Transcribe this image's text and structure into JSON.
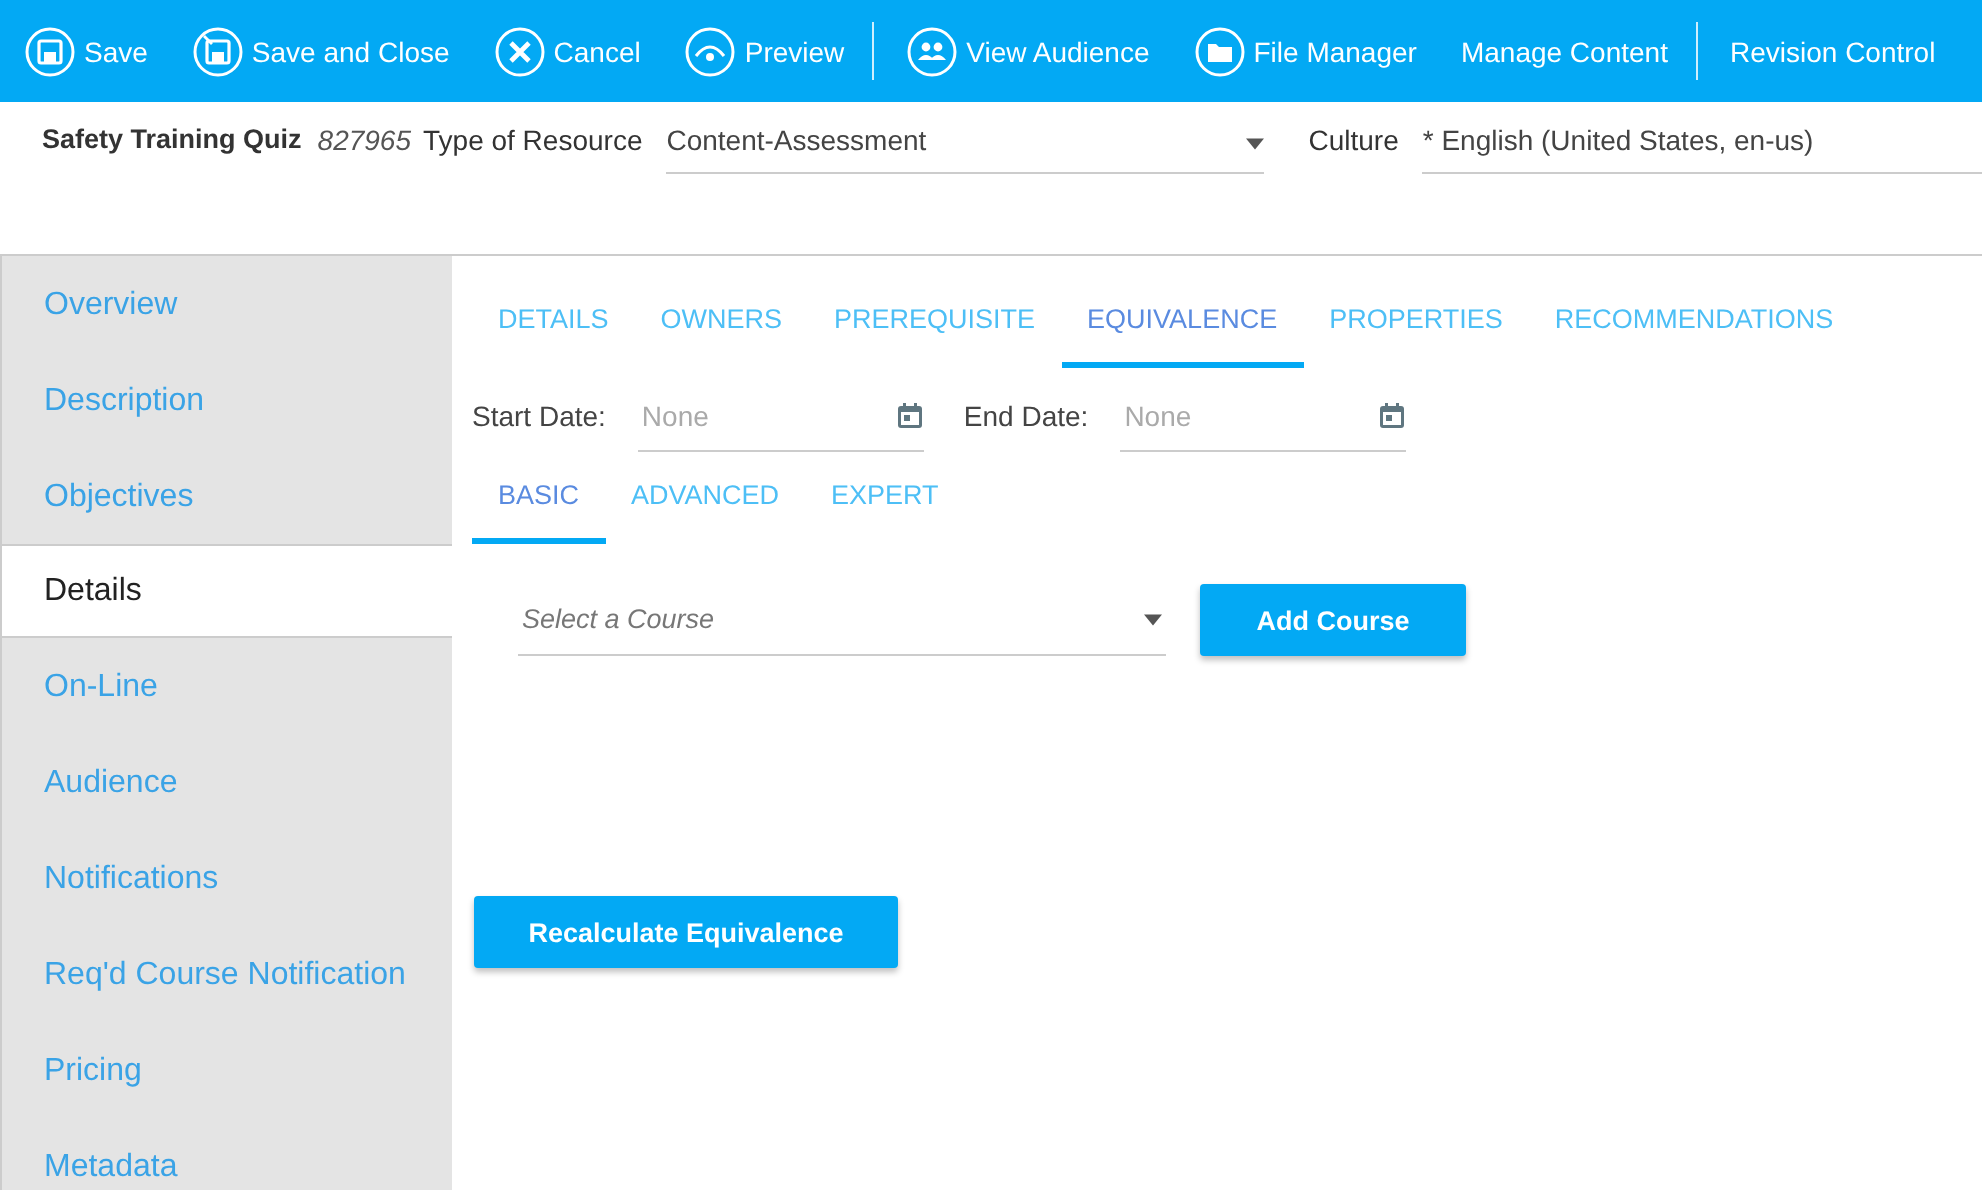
{
  "toolbar": [
    {
      "kind": "save",
      "label": "Save"
    },
    {
      "kind": "saveclose",
      "label": "Save and Close"
    },
    {
      "kind": "cancel",
      "label": "Cancel"
    },
    {
      "kind": "preview",
      "label": "Preview"
    },
    {
      "kind": "divider"
    },
    {
      "kind": "audience",
      "label": "View Audience"
    },
    {
      "kind": "folder",
      "label": "File Manager"
    },
    {
      "kind": "text",
      "label": "Manage Content"
    },
    {
      "kind": "divider"
    },
    {
      "kind": "text",
      "label": "Revision Control"
    }
  ],
  "header": {
    "title": "Safety Training Quiz",
    "id": "827965",
    "type_label": "Type of Resource",
    "type_value": "Content-Assessment",
    "culture_label": "Culture",
    "culture_value": "* English (United States, en-us)"
  },
  "sidebar": {
    "items": [
      {
        "label": "Overview",
        "selected": false
      },
      {
        "label": "Description",
        "selected": false
      },
      {
        "label": "Objectives",
        "selected": false
      },
      {
        "label": "Details",
        "selected": true
      },
      {
        "label": "On-Line",
        "selected": false
      },
      {
        "label": "Audience",
        "selected": false
      },
      {
        "label": "Notifications",
        "selected": false
      },
      {
        "label": "Req'd Course Notification",
        "selected": false
      },
      {
        "label": "Pricing",
        "selected": false
      },
      {
        "label": "Metadata",
        "selected": false
      }
    ]
  },
  "tabs": [
    {
      "label": "DETAILS",
      "selected": false
    },
    {
      "label": "OWNERS",
      "selected": false
    },
    {
      "label": "PREREQUISITE",
      "selected": false
    },
    {
      "label": "EQUIVALENCE",
      "selected": true
    },
    {
      "label": "PROPERTIES",
      "selected": false
    },
    {
      "label": "RECOMMENDATIONS",
      "selected": false
    }
  ],
  "dates": [
    {
      "label": "Start Date:",
      "placeholder": "None"
    },
    {
      "label": "End Date:",
      "placeholder": "None"
    }
  ],
  "subtabs": [
    {
      "label": "BASIC",
      "selected": true
    },
    {
      "label": "ADVANCED",
      "selected": false
    },
    {
      "label": "EXPERT",
      "selected": false
    }
  ],
  "course_select": {
    "placeholder": "Select a Course"
  },
  "add_button": "Add Course",
  "recalc_button": "Recalculate Equivalence"
}
